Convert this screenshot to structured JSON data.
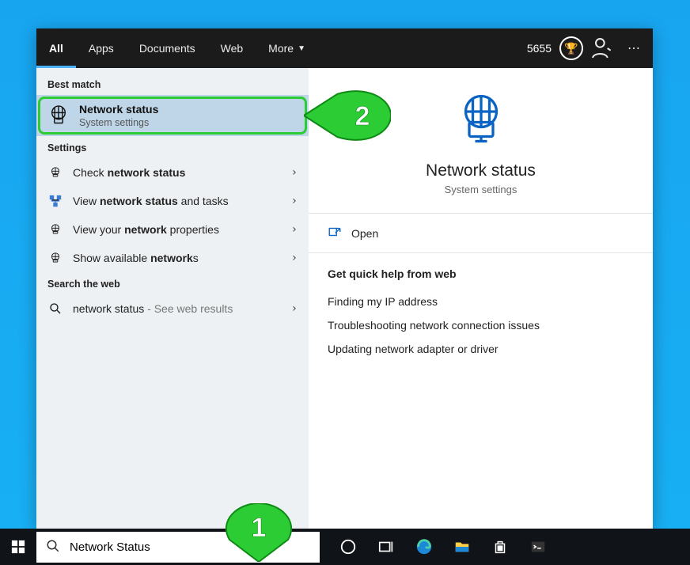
{
  "top": {
    "tabs": [
      "All",
      "Apps",
      "Documents",
      "Web",
      "More"
    ],
    "points": "5655"
  },
  "left": {
    "best_match_label": "Best match",
    "best_match": {
      "title": "Network status",
      "subtitle": "System settings"
    },
    "settings_label": "Settings",
    "settings": [
      {
        "pre": "Check ",
        "bold": "network status",
        "post": ""
      },
      {
        "pre": "View ",
        "bold": "network status",
        "post": " and tasks"
      },
      {
        "pre": "View your ",
        "bold": "network",
        "post": " properties"
      },
      {
        "pre": "Show available ",
        "bold": "network",
        "post": "s"
      }
    ],
    "web_label": "Search the web",
    "web": {
      "term": "network status",
      "suffix": " - See web results"
    }
  },
  "right": {
    "title": "Network status",
    "subtitle": "System settings",
    "open": "Open",
    "help_label": "Get quick help from web",
    "help_links": [
      "Finding my IP address",
      "Troubleshooting network connection issues",
      "Updating network adapter or driver"
    ]
  },
  "taskbar": {
    "search_value": "Network Status"
  },
  "annotations": {
    "step1": "1",
    "step2": "2"
  }
}
